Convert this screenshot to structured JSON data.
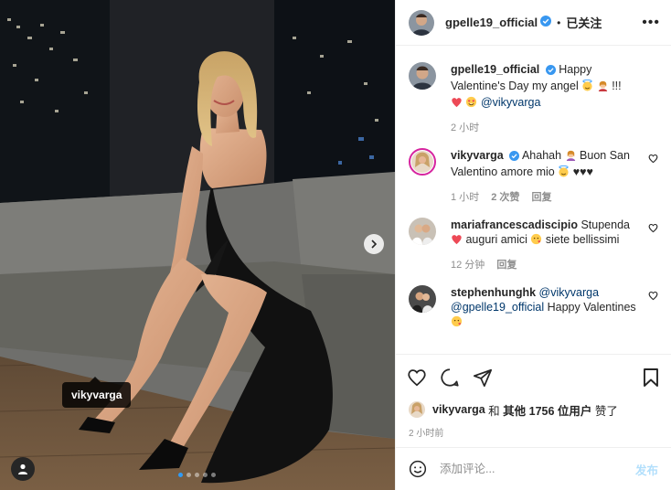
{
  "post": {
    "author": "gpelle19_official",
    "follow_status": "已关注",
    "separator": "•",
    "more_label": "•••"
  },
  "photo": {
    "tagged_user": "vikyvarga",
    "carousel_count": 5,
    "carousel_active": 1
  },
  "caption": {
    "user": "gpelle19_official",
    "text_1": "Happy Valentine's Day my angel",
    "text_2": "!!!",
    "mention": "@vikyvarga",
    "time": "2 小时"
  },
  "comments": [
    {
      "user": "vikyvarga",
      "text_1": "Ahahah",
      "text_2": "Buon San Valentino amore mio",
      "text_3": "♥♥♥",
      "time": "1 小时",
      "likes": "2 次赞",
      "reply": "回复"
    },
    {
      "user": "mariafrancescadiscipio",
      "text_1": "Stupenda",
      "text_2": "auguri amici",
      "text_3": "siete bellissimi",
      "time": "12 分钟",
      "reply": "回复"
    },
    {
      "user": "stephenhunghk",
      "mention_1": "@vikyvarga",
      "mention_2": "@gpelle19_official",
      "text_1": "Happy Valentines"
    }
  ],
  "likes": {
    "user": "vikyvarga",
    "connector": "和",
    "others": "其他 1756 位用户",
    "suffix": "赞了"
  },
  "timestamp": "2 小时前",
  "composer": {
    "placeholder": "添加评论...",
    "post_label": "发布"
  },
  "colors": {
    "verified": "#3897f0",
    "heart": "#ed4956",
    "mention": "#00376b",
    "post_disabled": "#b2dffc",
    "carousel_active": "#2f9bf7"
  },
  "icons": [
    "verified-badge-icon",
    "heart-icon",
    "comment-icon",
    "share-icon",
    "bookmark-icon",
    "emoji-icon",
    "chevron-right-icon",
    "user-tag-icon"
  ]
}
